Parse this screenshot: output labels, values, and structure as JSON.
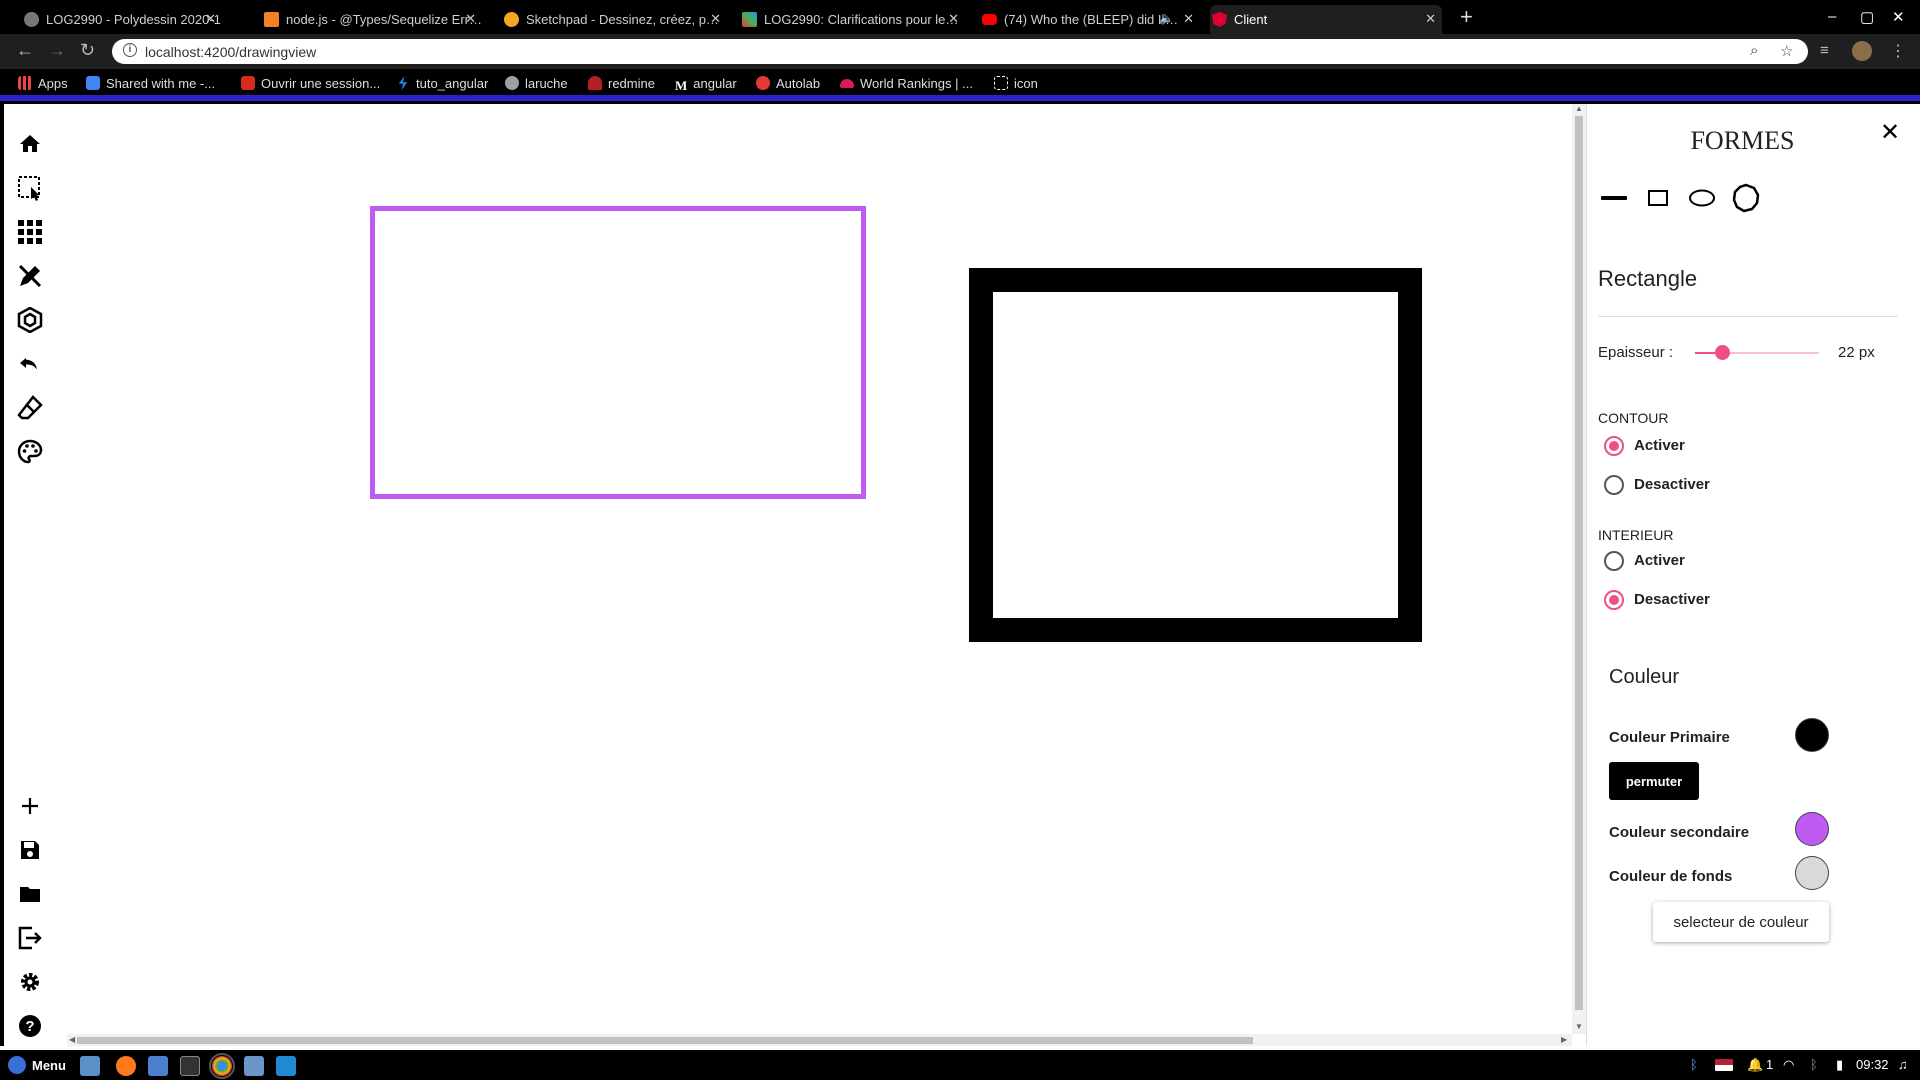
{
  "browser": {
    "tabs": [
      {
        "title": "LOG2990 - Polydessin 2020-1 …",
        "icon": "globe-icon",
        "color": "#9aa0a6"
      },
      {
        "title": "node.js - @Types/Sequelize Err…",
        "icon": "stackoverflow-icon",
        "color": "#f48024"
      },
      {
        "title": "Sketchpad - Dessinez, créez, p…",
        "icon": "sketchpad-icon",
        "color": "#f5a623"
      },
      {
        "title": "LOG2990: Clarifications pour le…",
        "icon": "colorful-icon",
        "color": "#4caf50"
      },
      {
        "title": "(74) Who the (BLEEP) did I …",
        "icon": "youtube-icon",
        "color": "#ff0000"
      },
      {
        "title": "Client",
        "icon": "angular-icon",
        "color": "#dd0031"
      }
    ],
    "url": "localhost:4200/drawingview",
    "bookmarks": [
      {
        "label": "Apps",
        "icon": "apps-grid-icon",
        "color": "#e8453c"
      },
      {
        "label": "Shared with me -...",
        "icon": "drive-icon",
        "color": "#4285f4"
      },
      {
        "label": "Ouvrir une session...",
        "icon": "maple-leaf-icon",
        "color": "#d52b1e"
      },
      {
        "label": "tuto_angular",
        "icon": "bolt-icon",
        "color": "#1e88e5"
      },
      {
        "label": "laruche",
        "icon": "globe-icon",
        "color": "#9aa0a6"
      },
      {
        "label": "redmine",
        "icon": "redmine-icon",
        "color": "#b32024"
      },
      {
        "label": "angular",
        "icon": "m-icon",
        "color": "#ffffff"
      },
      {
        "label": "Autolab",
        "icon": "autolab-icon",
        "color": "#e53935"
      },
      {
        "label": "World Rankings | ...",
        "icon": "rankings-icon",
        "color": "#d81b60"
      },
      {
        "label": "icon",
        "icon": "icon-icon",
        "color": "#ffffff"
      }
    ]
  },
  "toolbar": {
    "top_tools": [
      "home-icon",
      "selection-icon",
      "grid-icon",
      "pencil-tools-icon",
      "polygon-icon",
      "undo-icon",
      "eraser-icon",
      "palette-icon"
    ],
    "bottom_tools": [
      "add-icon",
      "save-icon",
      "folder-icon",
      "export-icon",
      "settings-icon",
      "help-icon"
    ]
  },
  "canvas": {
    "shapes": [
      {
        "name": "rectangle-purple",
        "stroke_color": "#bf5af2",
        "fill": "none"
      },
      {
        "name": "rectangle-black",
        "stroke_color": "#000000",
        "fill": "#ffffff"
      }
    ]
  },
  "panel": {
    "title": "FORMES",
    "shape_tools": [
      "line-icon",
      "rectangle-icon",
      "ellipse-icon",
      "polygon-icon"
    ],
    "section_title": "Rectangle",
    "thickness_label": "Epaisseur :",
    "thickness_value": "22 px",
    "thickness_level": 0.22,
    "contour_label": "CONTOUR",
    "contour_options": [
      "Activer",
      "Desactiver"
    ],
    "contour_selected": 0,
    "interieur_label": "INTERIEUR",
    "interieur_options": [
      "Activer",
      "Desactiver"
    ],
    "interieur_selected": 1,
    "color_title": "Couleur",
    "primary_label": "Couleur Primaire",
    "primary_color": "#000000",
    "swap_button": "permuter",
    "secondary_label": "Couleur secondaire",
    "secondary_color": "#bf5af2",
    "background_label": "Couleur de fonds",
    "background_color": "#d9d9d9",
    "picker_button": "selecteur de couleur"
  },
  "taskbar": {
    "menu_label": "Menu",
    "tray_count": "1",
    "time": "09:32"
  }
}
